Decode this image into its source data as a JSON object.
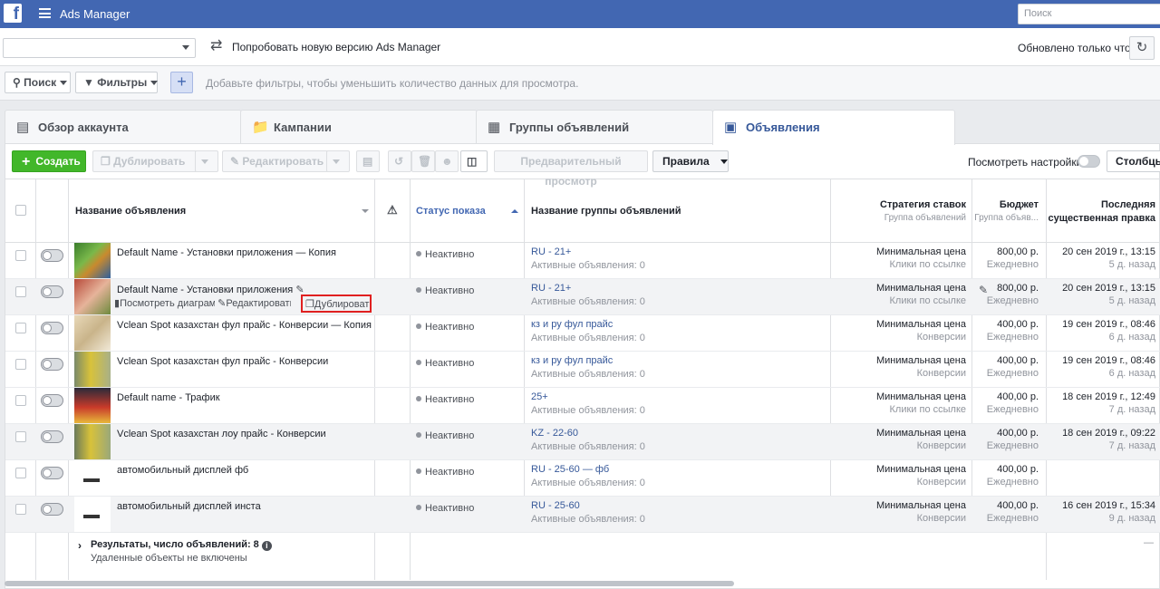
{
  "app": {
    "title": "Ads Manager",
    "search_placeholder": "Поиск"
  },
  "bar2": {
    "try_new": "Попробовать новую версию Ads Manager",
    "updated": "Обновлено только что"
  },
  "filters": {
    "search": "Поиск",
    "filters": "Фильтры",
    "hint": "Добавьте фильтры, чтобы уменьшить количество данных для просмотра."
  },
  "tabs": [
    {
      "label": "Обзор аккаунта"
    },
    {
      "label": "Кампании"
    },
    {
      "label": "Группы объявлений"
    },
    {
      "label": "Объявления"
    }
  ],
  "toolbar": {
    "create": "Создать",
    "duplicate": "Дублировать",
    "edit": "Редактировать",
    "preview": "Предварительный просмотр",
    "rules": "Правила",
    "view_settings": "Посмотреть настройки",
    "columns": "Столбцы:"
  },
  "columns": {
    "ad_name": "Название объявления",
    "status": "Статус показа",
    "adset_name": "Название группы объявлений",
    "bid": "Стратегия ставок",
    "bid_sub": "Группа объявлений",
    "budget": "Бюджет",
    "budget_sub": "Группа объяв...",
    "last_edit_1": "Последняя",
    "last_edit_2": "существенная правка"
  },
  "row_actions": {
    "chart": "Посмотреть диаграммы",
    "edit": "Редактировать",
    "duplicate": "Дублироват"
  },
  "rows": [
    {
      "name": "Default Name - Установки приложения — Копия",
      "status": "Неактивно",
      "adset": "RU - 21+",
      "adset_sub": "Активные объявления: 0",
      "bid": "Минимальная цена",
      "bid_sub": "Клики по ссылке",
      "budget": "800,00 р.",
      "budget_sub": "Ежедневно",
      "edit": "20 сен 2019 г., 13:15",
      "edit_sub": "5 д. назад"
    },
    {
      "name": "Default Name - Установки приложения",
      "status": "Неактивно",
      "adset": "RU - 21+",
      "adset_sub": "Активные объявления: 0",
      "bid": "Минимальная цена",
      "bid_sub": "Клики по ссылке",
      "budget": "800,00 р.",
      "budget_sub": "Ежедневно",
      "edit": "20 сен 2019 г., 13:15",
      "edit_sub": "5 д. назад"
    },
    {
      "name": "Vclean Spot казахстан фул прайс - Конверсии — Копия",
      "status": "Неактивно",
      "adset": "кз и ру фул прайс",
      "adset_sub": "Активные объявления: 0",
      "bid": "Минимальная цена",
      "bid_sub": "Конверсии",
      "budget": "400,00 р.",
      "budget_sub": "Ежедневно",
      "edit": "19 сен 2019 г., 08:46",
      "edit_sub": "6 д. назад"
    },
    {
      "name": "Vclean Spot казахстан фул прайс - Конверсии",
      "status": "Неактивно",
      "adset": "кз и ру фул прайс",
      "adset_sub": "Активные объявления: 0",
      "bid": "Минимальная цена",
      "bid_sub": "Конверсии",
      "budget": "400,00 р.",
      "budget_sub": "Ежедневно",
      "edit": "19 сен 2019 г., 08:46",
      "edit_sub": "6 д. назад"
    },
    {
      "name": "Default name - Трафик",
      "status": "Неактивно",
      "adset": "25+",
      "adset_sub": "Активные объявления: 0",
      "bid": "Минимальная цена",
      "bid_sub": "Клики по ссылке",
      "budget": "400,00 р.",
      "budget_sub": "Ежедневно",
      "edit": "18 сен 2019 г., 12:49",
      "edit_sub": "7 д. назад"
    },
    {
      "name": "Vclean Spot казахстан лоу прайс - Конверсии",
      "status": "Неактивно",
      "adset": "KZ - 22-60",
      "adset_sub": "Активные объявления: 0",
      "bid": "Минимальная цена",
      "bid_sub": "Конверсии",
      "budget": "400,00 р.",
      "budget_sub": "Ежедневно",
      "edit": "18 сен 2019 г., 09:22",
      "edit_sub": "7 д. назад"
    },
    {
      "name": "автомобильный дисплей фб",
      "status": "Неактивно",
      "adset": "RU - 25-60 — фб",
      "adset_sub": "Активные объявления: 0",
      "bid": "Минимальная цена",
      "bid_sub": "Конверсии",
      "budget": "400,00 р.",
      "budget_sub": "Ежедневно",
      "edit": "",
      "edit_sub": ""
    },
    {
      "name": "автомобильный дисплей инста",
      "status": "Неактивно",
      "adset": "RU - 25-60",
      "adset_sub": "Активные объявления: 0",
      "bid": "Минимальная цена",
      "bid_sub": "Конверсии",
      "budget": "400,00 р.",
      "budget_sub": "Ежедневно",
      "edit": "16 сен 2019 г., 15:34",
      "edit_sub": "9 д. назад"
    }
  ],
  "summary": {
    "results": "Результаты, число объявлений: 8",
    "deleted": "Удаленные объекты не включены",
    "dash": "—"
  },
  "colors": {
    "brand": "#4267b2",
    "create": "#42b72a",
    "highlight": "#e02020",
    "link": "#365899"
  }
}
